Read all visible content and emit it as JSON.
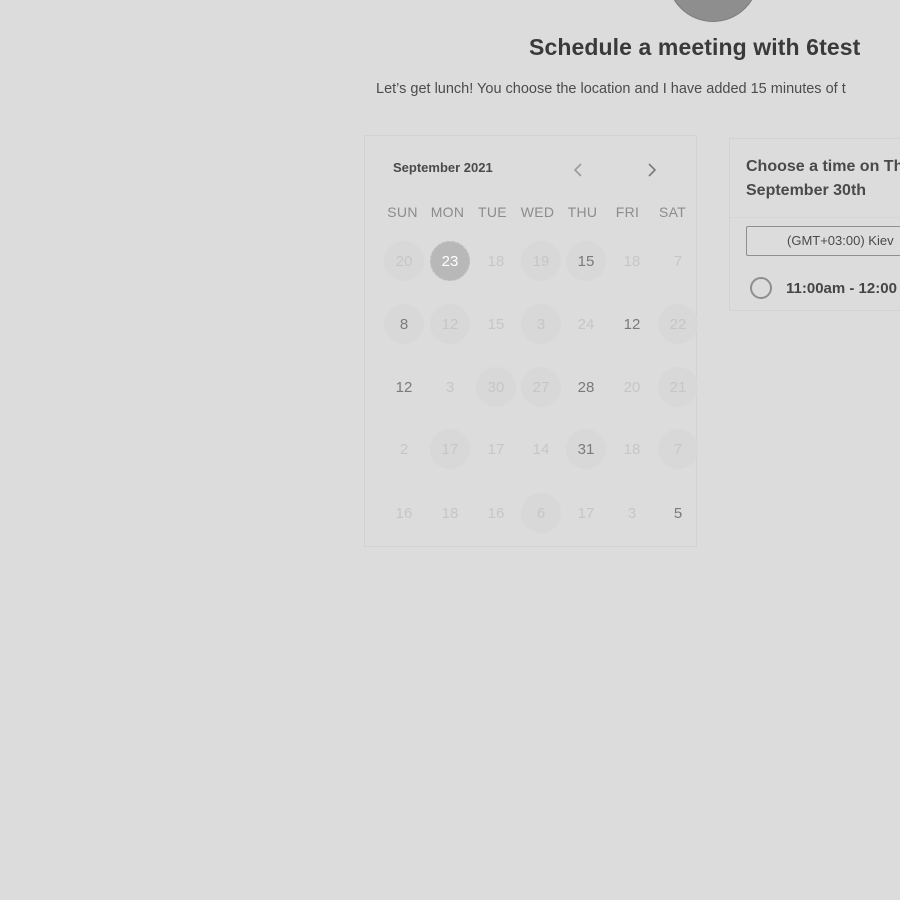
{
  "header": {
    "title": "Schedule a meeting with 6test",
    "description": "Let’s get lunch! You choose the location and I have added 15 minutes of t"
  },
  "calendar": {
    "month_label": "September 2021",
    "prev_icon": "chevron-left-icon",
    "next_icon": "chevron-right-icon",
    "weekdays": [
      "SUN",
      "MON",
      "TUE",
      "WED",
      "THU",
      "FRI",
      "SAT"
    ],
    "weeks": [
      [
        {
          "label": "20",
          "state": "muted",
          "shade": true
        },
        {
          "label": "23",
          "state": "selected",
          "shade": true
        },
        {
          "label": "18",
          "state": "muted",
          "shade": false
        },
        {
          "label": "19",
          "state": "muted",
          "shade": true
        },
        {
          "label": "15",
          "state": "available",
          "shade": true
        },
        {
          "label": "18",
          "state": "muted",
          "shade": false
        },
        {
          "label": "7",
          "state": "muted",
          "shade": false
        }
      ],
      [
        {
          "label": "8",
          "state": "available",
          "shade": true
        },
        {
          "label": "12",
          "state": "muted",
          "shade": true
        },
        {
          "label": "15",
          "state": "muted",
          "shade": false
        },
        {
          "label": "3",
          "state": "muted",
          "shade": true
        },
        {
          "label": "24",
          "state": "muted",
          "shade": false
        },
        {
          "label": "12",
          "state": "available",
          "shade": false
        },
        {
          "label": "22",
          "state": "muted",
          "shade": true
        }
      ],
      [
        {
          "label": "12",
          "state": "available",
          "shade": false
        },
        {
          "label": "3",
          "state": "muted",
          "shade": false
        },
        {
          "label": "30",
          "state": "muted",
          "shade": true
        },
        {
          "label": "27",
          "state": "muted",
          "shade": true
        },
        {
          "label": "28",
          "state": "available",
          "shade": false
        },
        {
          "label": "20",
          "state": "muted",
          "shade": false
        },
        {
          "label": "21",
          "state": "muted",
          "shade": true
        }
      ],
      [
        {
          "label": "2",
          "state": "muted",
          "shade": false
        },
        {
          "label": "17",
          "state": "muted",
          "shade": true
        },
        {
          "label": "17",
          "state": "muted",
          "shade": false
        },
        {
          "label": "14",
          "state": "muted",
          "shade": false
        },
        {
          "label": "31",
          "state": "available",
          "shade": true
        },
        {
          "label": "18",
          "state": "muted",
          "shade": false
        },
        {
          "label": "7",
          "state": "muted",
          "shade": true
        }
      ],
      [
        {
          "label": "16",
          "state": "muted",
          "shade": false
        },
        {
          "label": "18",
          "state": "muted",
          "shade": false
        },
        {
          "label": "16",
          "state": "muted",
          "shade": false
        },
        {
          "label": "6",
          "state": "muted",
          "shade": true
        },
        {
          "label": "17",
          "state": "muted",
          "shade": false
        },
        {
          "label": "3",
          "state": "muted",
          "shade": false
        },
        {
          "label": "5",
          "state": "available",
          "shade": false
        }
      ]
    ]
  },
  "times": {
    "heading_line1": "Choose a time on Th",
    "heading_line2": "September 30th",
    "timezone": "(GMT+03:00) Kiev",
    "slots": [
      {
        "label": "11:00am - 12:00",
        "radio_icon": "radio-unchecked-icon"
      }
    ]
  },
  "colors": {
    "background": "#dcdcdc",
    "selected_day": "#b8b8b8",
    "avatar": "#8e8e8e"
  }
}
